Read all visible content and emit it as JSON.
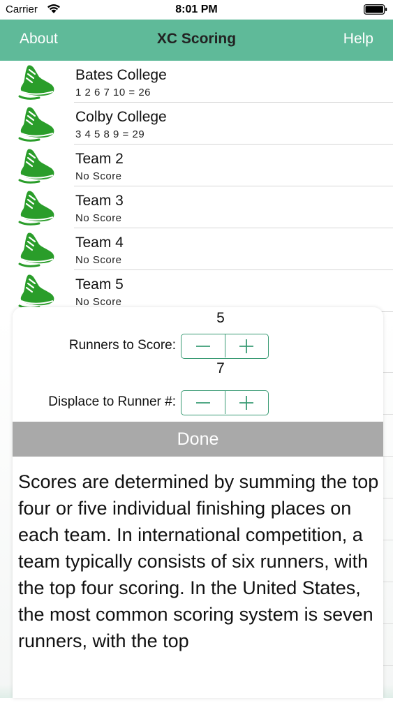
{
  "status_bar": {
    "carrier": "Carrier",
    "time": "8:01 PM"
  },
  "nav": {
    "left_label": "About",
    "title": "XC Scoring",
    "right_label": "Help"
  },
  "colors": {
    "nav_background": "#5fba99",
    "shoe_green": "#2a9d2a",
    "stepper_tint": "#3a9b74",
    "done_background": "#a9a9a9"
  },
  "teams": [
    {
      "name": "Bates College",
      "score": "1 2 6 7 10 = 26",
      "icon": "running-shoe-icon"
    },
    {
      "name": "Colby College",
      "score": "3 4 5 8 9 = 29",
      "icon": "running-shoe-icon"
    },
    {
      "name": "Team 2",
      "score": "No Score",
      "icon": "running-shoe-icon"
    },
    {
      "name": "Team 3",
      "score": "No Score",
      "icon": "running-shoe-icon"
    },
    {
      "name": "Team 4",
      "score": "No Score",
      "icon": "running-shoe-icon"
    },
    {
      "name": "Team 5",
      "score": "No Score",
      "icon": "running-shoe-icon"
    }
  ],
  "settings": {
    "runners_to_score": {
      "value": "5",
      "label": "Runners to Score:"
    },
    "displace_to_runner": {
      "value": "7",
      "label": "Displace to Runner #:"
    },
    "minus_symbol": "−",
    "plus_symbol": "+",
    "done_label": "Done"
  },
  "description": "Scores are determined by summing the top four or five individual finishing places on each team. In international competition, a team typically consists of six runners, with the top four scoring. In the United States, the most common scoring system is seven runners, with the top"
}
